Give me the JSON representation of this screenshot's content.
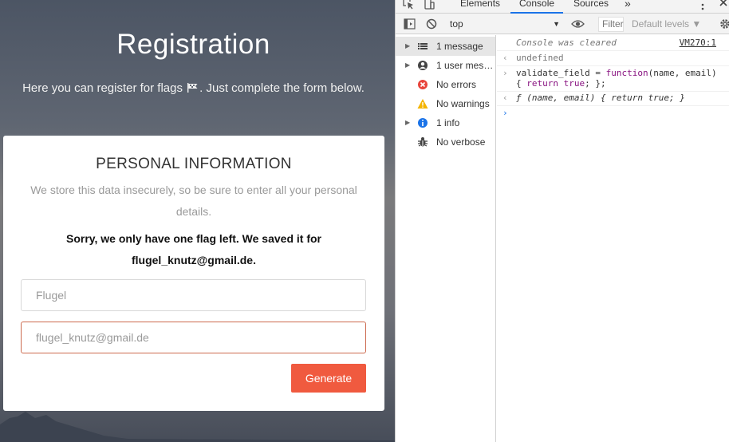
{
  "page": {
    "title": "Registration",
    "subtitle_before": "Here you can register for flags",
    "subtitle_after": ". Just complete the form below.",
    "card": {
      "heading": "PERSONAL INFORMATION",
      "description": "We store this data insecurely, so be sure to enter all your personal details.",
      "alert": "Sorry, we only have one flag left. We saved it for flugel_knutz@gmail.de.",
      "name_placeholder": "Flugel",
      "email_placeholder": "flugel_knutz@gmail.de",
      "generate_label": "Generate"
    }
  },
  "devtools": {
    "tabs": [
      "Elements",
      "Console",
      "Sources"
    ],
    "active_tab": "Console",
    "more_tabs": "»",
    "context": "top",
    "filter_placeholder": "Filter",
    "levels_label": "Default levels ▼",
    "sidebar": [
      {
        "label": "1 message",
        "icon": "list-icon",
        "expandable": true
      },
      {
        "label": "1 user mes…",
        "icon": "user-icon",
        "expandable": true
      },
      {
        "label": "No errors",
        "icon": "error-icon",
        "expandable": false
      },
      {
        "label": "No warnings",
        "icon": "warning-icon",
        "expandable": false
      },
      {
        "label": "1 info",
        "icon": "info-icon",
        "expandable": true
      },
      {
        "label": "No verbose",
        "icon": "bug-icon",
        "expandable": false
      }
    ],
    "console": {
      "cleared": "Console was cleared",
      "cleared_source": "VM270:1",
      "undefined": "undefined",
      "input_var": "validate_field",
      "input_eq": " = ",
      "input_kw": "function",
      "input_args": "(name, email)",
      "input_body_open": "{ ",
      "input_return": "return",
      "input_true": "true",
      "input_body_close": "; };",
      "output": "ƒ (name, email) { return true; }"
    }
  },
  "colors": {
    "accent": "#f05a3f",
    "devtools_blue": "#1a73e8",
    "error_red": "#e8453c",
    "warning_yellow": "#f4b400"
  }
}
